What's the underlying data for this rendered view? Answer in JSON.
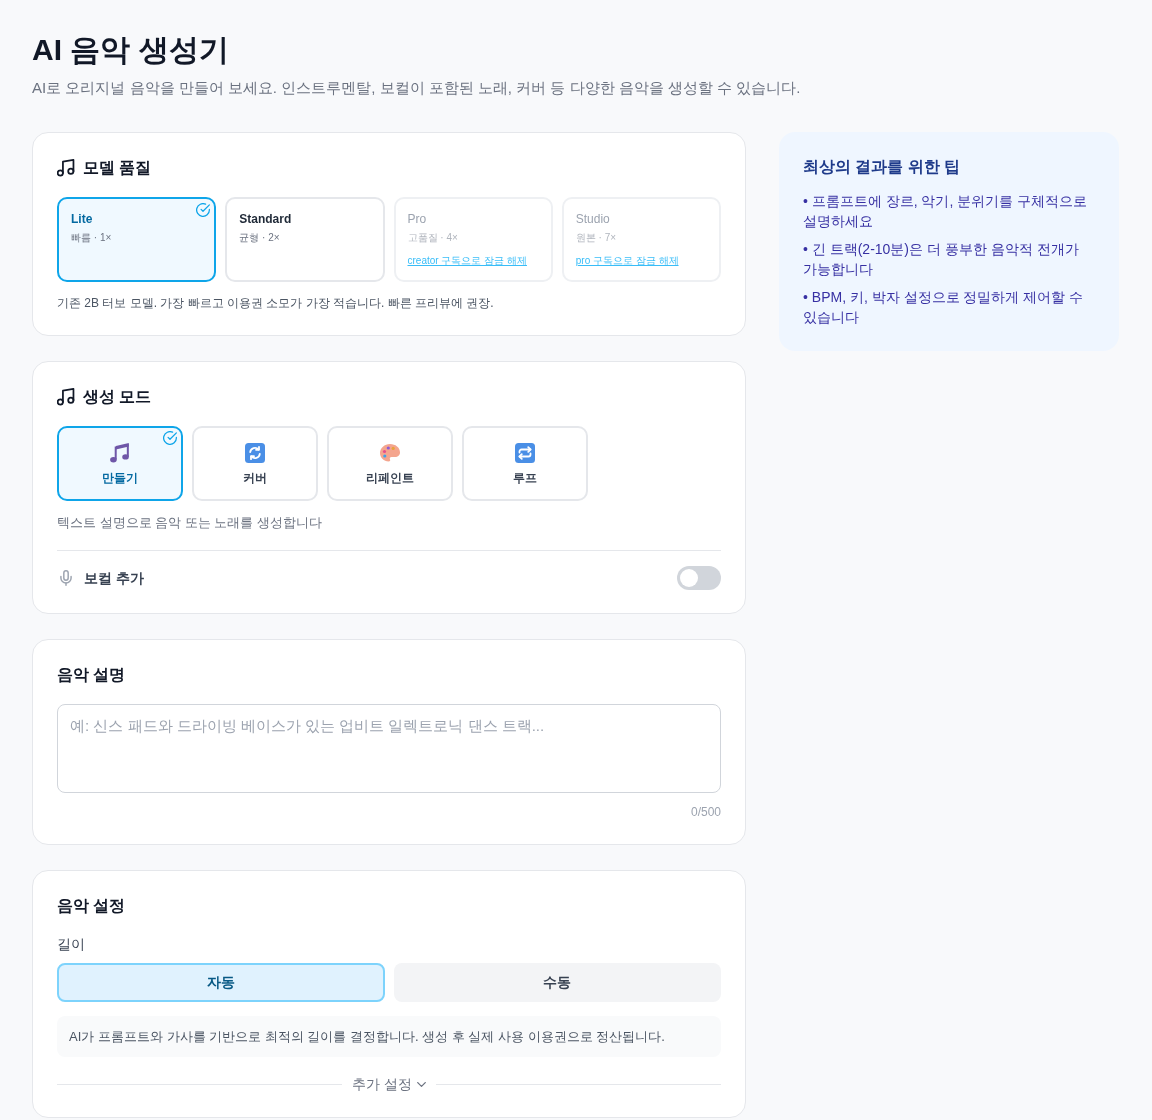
{
  "header": {
    "title": "AI 음악 생성기",
    "subtitle": "AI로 오리지널 음악을 만들어 보세요. 인스트루멘탈, 보컬이 포함된 노래, 커버 등 다양한 음악을 생성할 수 있습니다."
  },
  "model_quality": {
    "title": "모델 품질",
    "options": [
      {
        "name": "Lite",
        "detail": "빠름 · 1×",
        "selected": true,
        "locked": false
      },
      {
        "name": "Standard",
        "detail": "균형 · 2×",
        "selected": false,
        "locked": false
      },
      {
        "name": "Pro",
        "detail": "고품질 · 4×",
        "selected": false,
        "locked": true,
        "unlock_link": "creator 구독으로 잠금 해제"
      },
      {
        "name": "Studio",
        "detail": "원본 · 7×",
        "selected": false,
        "locked": true,
        "unlock_link": "pro 구독으로 잠금 해제"
      }
    ],
    "description": "기존 2B 터보 모델. 가장 빠르고 이용권 소모가 가장 적습니다. 빠른 프리뷰에 권장."
  },
  "generation_mode": {
    "title": "생성 모드",
    "modes": [
      {
        "label": "만들기",
        "kind": "create",
        "selected": true
      },
      {
        "label": "커버",
        "kind": "cover",
        "selected": false
      },
      {
        "label": "리페인트",
        "kind": "repaint",
        "selected": false
      },
      {
        "label": "루프",
        "kind": "loop",
        "selected": false
      }
    ],
    "description": "텍스트 설명으로 음악 또는 노래를 생성합니다",
    "vocal": {
      "label": "보컬 추가",
      "on": false
    }
  },
  "music_description": {
    "title": "음악 설명",
    "placeholder": "예: 신스 패드와 드라이빙 베이스가 있는 업비트 일렉트로닉 댄스 트랙...",
    "counter": "0/500"
  },
  "music_settings": {
    "title": "음악 설정",
    "length": {
      "label": "길이",
      "options": [
        {
          "label": "자동",
          "selected": true
        },
        {
          "label": "수동",
          "selected": false
        }
      ]
    },
    "info": "AI가 프롬프트와 가사를 기반으로 최적의 길이를 결정합니다. 생성 후 실제 사용 이용권으로 정산됩니다.",
    "more_settings": "추가 설정"
  },
  "tips": {
    "title": "최상의 결과를 위한 팁",
    "items": [
      "• 프롬프트에 장르, 악기, 분위기를 구체적으로 설명하세요",
      "• 긴 트랙(2-10분)은 더 풍부한 음악적 전개가 가능합니다",
      "• BPM, 키, 박자 설정으로 정밀하게 제어할 수 있습니다"
    ]
  }
}
